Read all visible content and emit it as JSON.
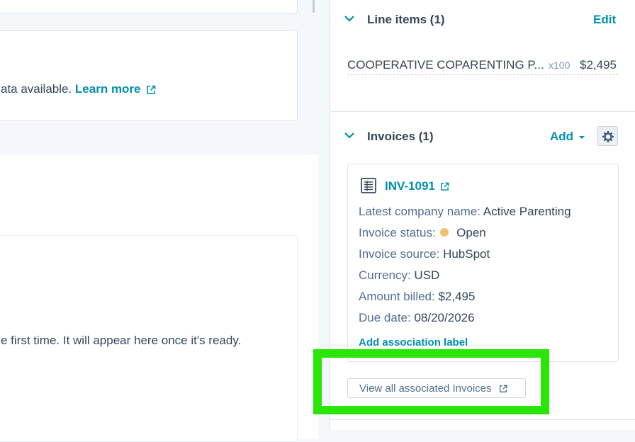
{
  "left": {
    "empty_msg_prefix": "ata available.",
    "learn_more": "Learn more",
    "ready_msg": "e first time. It will appear here once it's ready."
  },
  "line_items": {
    "title": "Line items (1)",
    "edit_label": "Edit",
    "item_name": "COOPERATIVE COPARENTING P...",
    "item_qty": "x100",
    "item_price": "$2,495"
  },
  "invoices": {
    "title": "Invoices (1)",
    "add_label": "Add",
    "invoice_id": "INV-1091",
    "props": [
      {
        "label": "Latest company name:",
        "value": "Active Parenting"
      },
      {
        "label": "Invoice status:",
        "value": "Open"
      },
      {
        "label": "Invoice source:",
        "value": "HubSpot"
      },
      {
        "label": "Currency:",
        "value": "USD"
      },
      {
        "label": "Amount billed:",
        "value": "$2,495"
      },
      {
        "label": "Due date:",
        "value": "08/20/2026"
      }
    ],
    "status_color": "#f5c26b",
    "add_association_label": "Add association label",
    "view_all_label": "View all associated Invoices"
  },
  "colors": {
    "accent": "#0091ae",
    "highlight": "#29e607"
  }
}
